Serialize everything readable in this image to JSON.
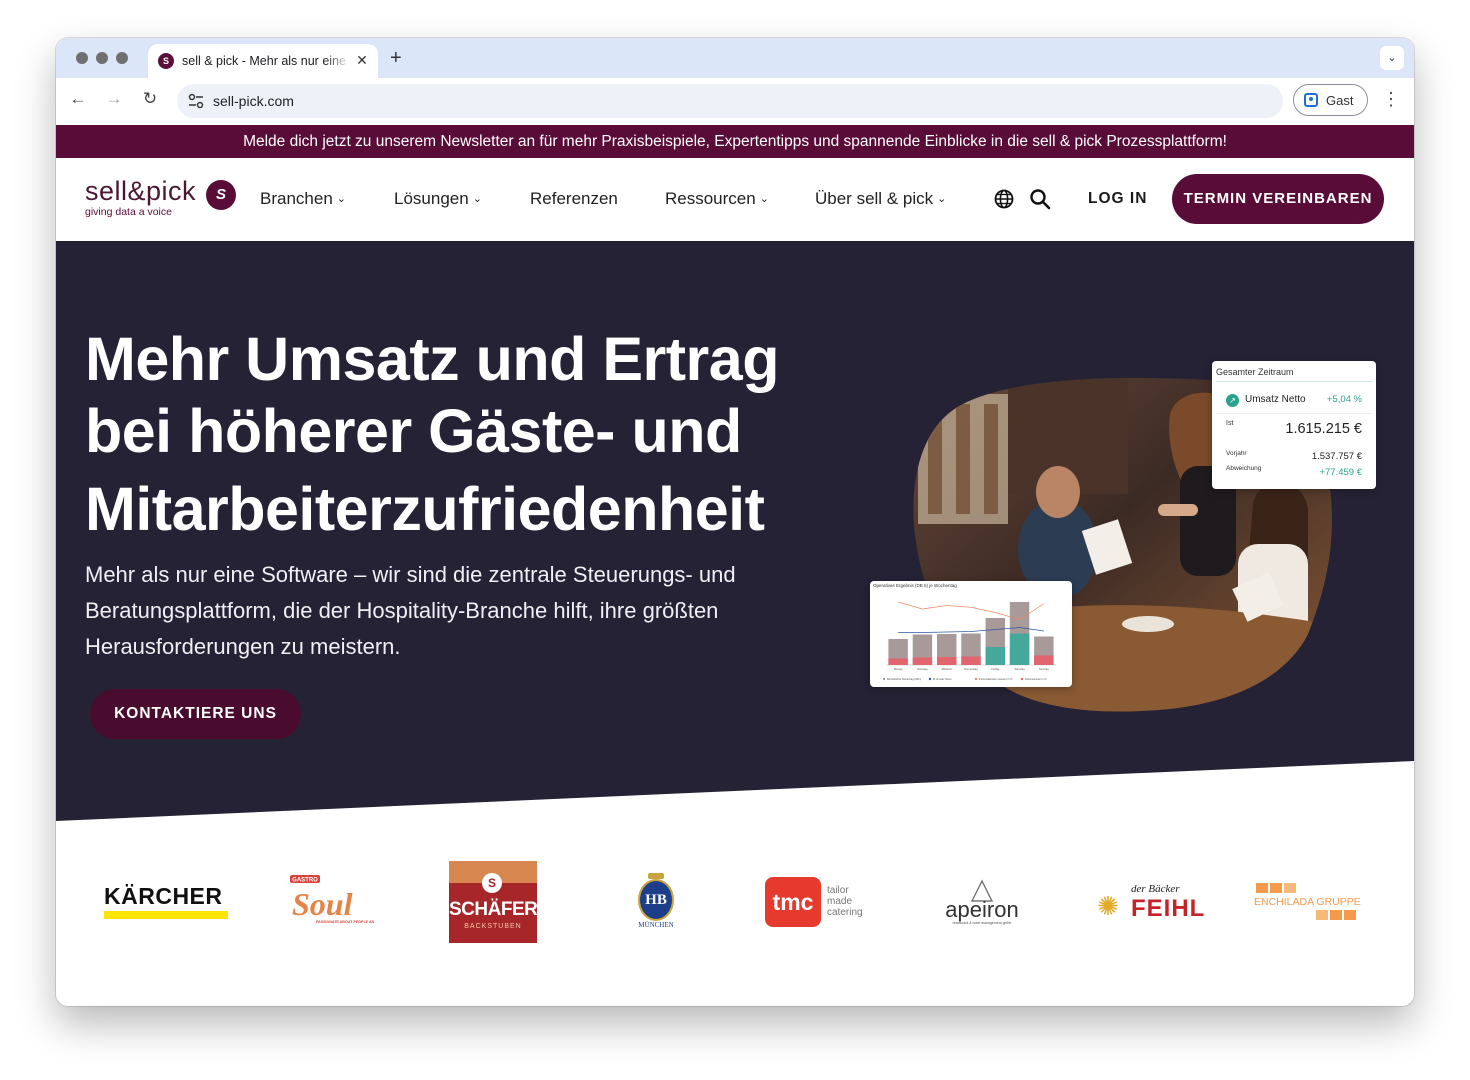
{
  "browser": {
    "tab_title": "sell & pick - Mehr als nur eine Software",
    "url": "sell-pick.com",
    "profile_label": "Gast"
  },
  "banner": {
    "text": "Melde dich jetzt zu unserem Newsletter an für mehr Praxisbeispiele, Expertentipps und spannende Einblicke in die sell & pick Prozessplattform!"
  },
  "nav": {
    "logo_text": "sell&pick",
    "logo_tagline": "giving data a voice",
    "items": [
      {
        "label": "Branchen",
        "dropdown": true
      },
      {
        "label": "Lösungen",
        "dropdown": true
      },
      {
        "label": "Referenzen",
        "dropdown": false
      },
      {
        "label": "Ressourcen",
        "dropdown": true
      },
      {
        "label": "Über sell & pick",
        "dropdown": true
      }
    ],
    "login": "LOG IN",
    "cta": "TERMIN VEREINBAREN"
  },
  "hero": {
    "title_lines": [
      "Mehr Umsatz und Ertrag",
      "bei höherer Gäste- und",
      "Mitarbeiterzufriedenheit"
    ],
    "subtitle": "Mehr als nur eine Software – wir sind die zentrale Steuerungs- und Beratungsplattform, die der Hospitality-Branche hilft, ihre größten Herausforderungen zu meistern.",
    "cta": "KONTAKTIERE UNS"
  },
  "kpi_card": {
    "period": "Gesamter Zeitraum",
    "label": "Umsatz Netto",
    "change": "+5,04 %",
    "ist_label": "Ist",
    "ist_value": "1.615.215 €",
    "vorjahr_label": "Vorjahr",
    "vorjahr_value": "1.537.757 €",
    "abweichung_label": "Abweichung",
    "abweichung_value": "+77.459 €"
  },
  "chart_data": {
    "type": "bar",
    "title": "Operatives Ergebnis (DB II) je Wochentag",
    "categories": [
      "Montag",
      "Dienstag",
      "Mittwoch",
      "Donnerstag",
      "Freitag",
      "Samstag",
      "Sonntag"
    ],
    "series": [
      {
        "name": "Betrieblicher Rohertrag (DB I)",
        "values": [
          5200,
          6100,
          6200,
          6300,
          9400,
          12600,
          5700
        ]
      },
      {
        "name": "Ø Umsatz Netto",
        "values": [
          6500,
          6500,
          6600,
          6700,
          7100,
          7500,
          6800
        ]
      },
      {
        "name": "Personalkosten Gesamt in %",
        "values": [
          36,
          32,
          34,
          33,
          30,
          26,
          35
        ]
      },
      {
        "name": "Wareneinsatz in %",
        "values": [
          30,
          29,
          30,
          28,
          27,
          25,
          29
        ]
      }
    ],
    "highlight_values": [
      1300,
      1500,
      1600,
      1700,
      3600,
      6300,
      1900
    ],
    "colors": {
      "bar": "#a79a98",
      "negative": "#e2646f",
      "positive": "#45a89a",
      "line": "#e98a5e"
    }
  },
  "logos": [
    {
      "name": "KÄRCHER"
    },
    {
      "name": "Gastro Soul",
      "tagline": "PASSIONATE ABOUT PEOPLE AND BRANDS"
    },
    {
      "name": "SCHÄFERS",
      "tagline": "BACKSTUBEN"
    },
    {
      "name": "HB",
      "tagline": "MÜNCHEN"
    },
    {
      "name": "tmc",
      "tagline": "tailor made catering"
    },
    {
      "name": "apeiron",
      "tagline": "restaurant & hotel management gmbh"
    },
    {
      "name": "FEIHL",
      "tagline": "der Bäcker"
    },
    {
      "name": "ENCHILADA GRUPPE"
    }
  ],
  "colors": {
    "brand": "#5a0c38",
    "hero_bg": "#262236",
    "accent_green": "#2aa38e"
  }
}
